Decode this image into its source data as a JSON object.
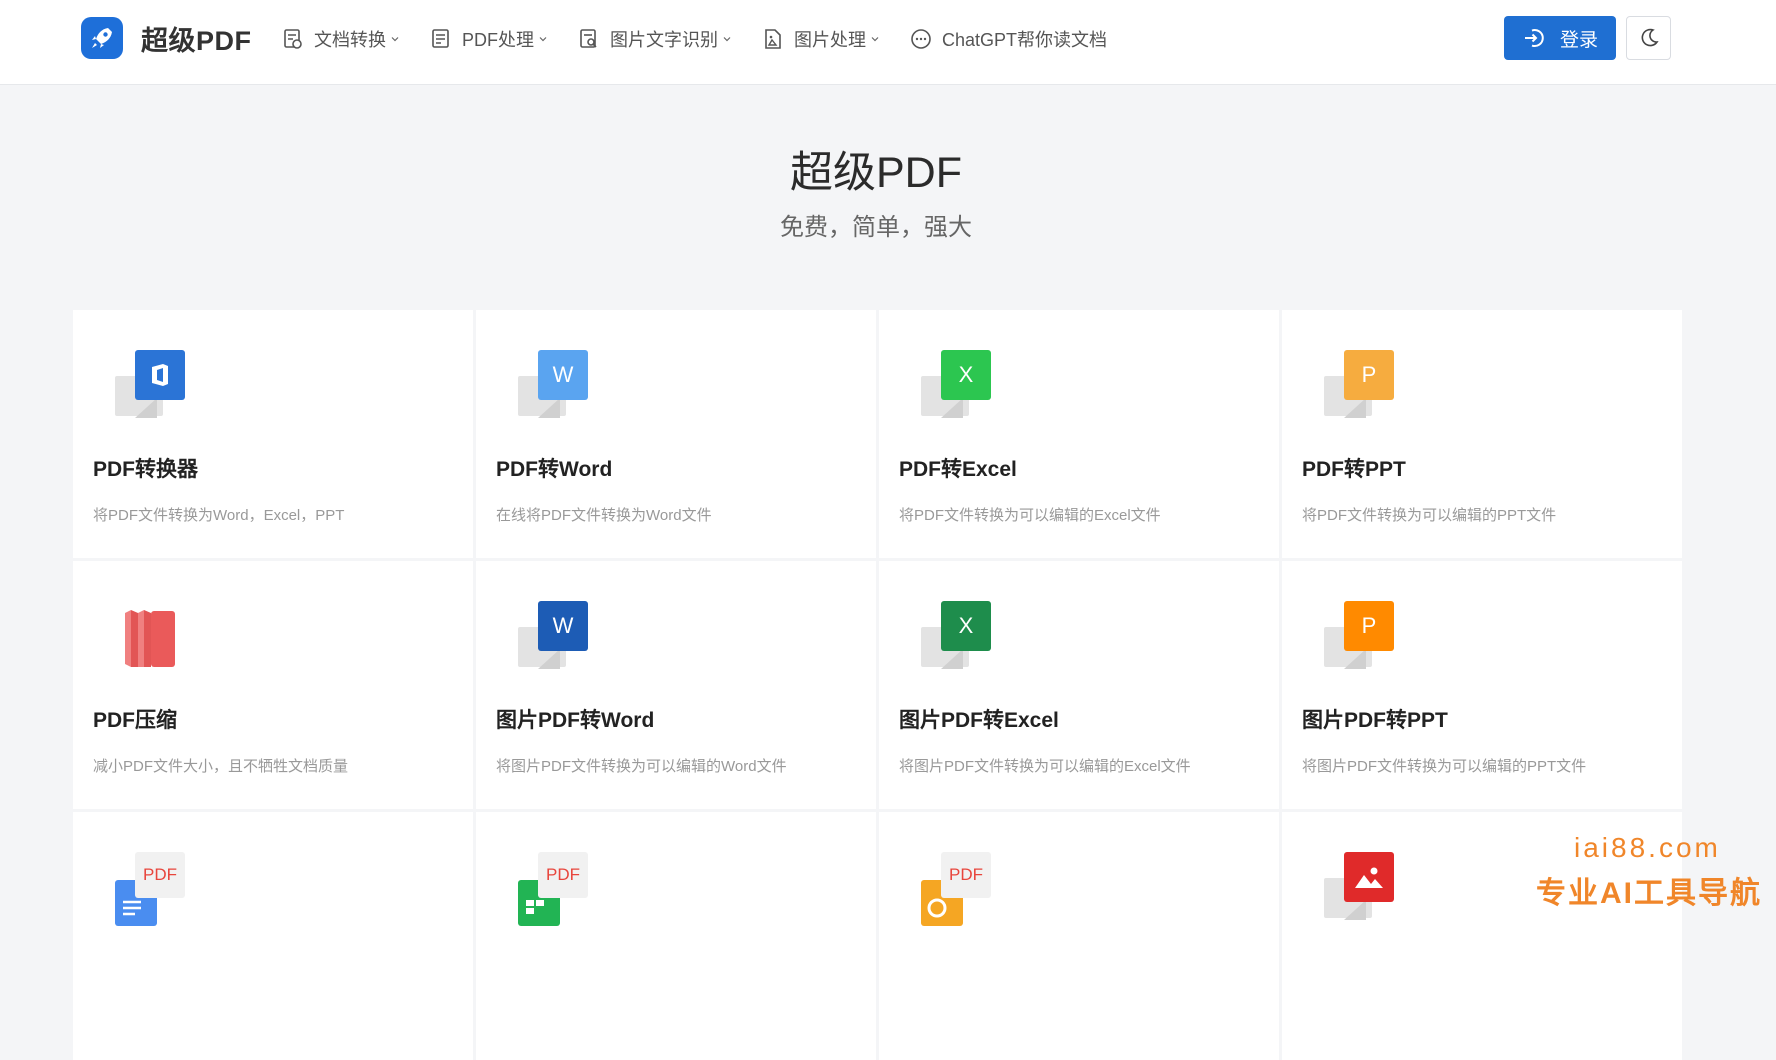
{
  "brand": {
    "name": "超级PDF",
    "color": "#1e6fd9"
  },
  "nav": {
    "items": [
      {
        "label": "文档转换",
        "icon": "doc-convert-icon",
        "dropdown": true
      },
      {
        "label": "PDF处理",
        "icon": "pdf-process-icon",
        "dropdown": true
      },
      {
        "label": "图片文字识别",
        "icon": "ocr-icon",
        "dropdown": true
      },
      {
        "label": "图片处理",
        "icon": "image-process-icon",
        "dropdown": true
      },
      {
        "label": "ChatGPT帮你读文档",
        "icon": "chat-icon",
        "dropdown": false
      }
    ],
    "login_label": "登录",
    "theme_icon": "moon-icon"
  },
  "hero": {
    "title": "超级PDF",
    "subtitle": "免费，简单，强大"
  },
  "tools": [
    {
      "title": "PDF转换器",
      "desc": "将PDF文件转换为Word，Excel，PPT",
      "icon": "office-icon",
      "color": "#2b74d6",
      "letter": ""
    },
    {
      "title": "PDF转Word",
      "desc": "在线将PDF文件转换为Word文件",
      "icon": "word-icon",
      "color": "#5aa4f0",
      "letter": "W"
    },
    {
      "title": "PDF转Excel",
      "desc": "将PDF文件转换为可以编辑的Excel文件",
      "icon": "excel-icon",
      "color": "#2cc650",
      "letter": "X"
    },
    {
      "title": "PDF转PPT",
      "desc": "将PDF文件转换为可以编辑的PPT文件",
      "icon": "ppt-icon",
      "color": "#f6ac3f",
      "letter": "P"
    },
    {
      "title": "PDF压缩",
      "desc": "减小PDF文件大小，且不牺牲文档质量",
      "icon": "compress-icon",
      "color": "#e94c4c",
      "letter": ""
    },
    {
      "title": "图片PDF转Word",
      "desc": "将图片PDF文件转换为可以编辑的Word文件",
      "icon": "word-icon",
      "color": "#1d5cb5",
      "letter": "W"
    },
    {
      "title": "图片PDF转Excel",
      "desc": "将图片PDF文件转换为可以编辑的Excel文件",
      "icon": "excel-icon",
      "color": "#1e8d4c",
      "letter": "X"
    },
    {
      "title": "图片PDF转PPT",
      "desc": "将图片PDF文件转换为可以编辑的PPT文件",
      "icon": "ppt-icon",
      "color": "#ff8a00",
      "letter": "P"
    },
    {
      "title": "",
      "desc": "",
      "icon": "word-to-pdf-icon",
      "color": "#4a8df0",
      "letter": "PDF"
    },
    {
      "title": "",
      "desc": "",
      "icon": "excel-to-pdf-icon",
      "color": "#22b454",
      "letter": "PDF"
    },
    {
      "title": "",
      "desc": "",
      "icon": "ppt-to-pdf-icon",
      "color": "#f5a623",
      "letter": "PDF"
    },
    {
      "title": "",
      "desc": "",
      "icon": "image-to-pdf-icon",
      "color": "#e02a2a",
      "letter": ""
    }
  ],
  "watermark": {
    "line1": "iai88.com",
    "line2": "专业AI工具导航"
  }
}
